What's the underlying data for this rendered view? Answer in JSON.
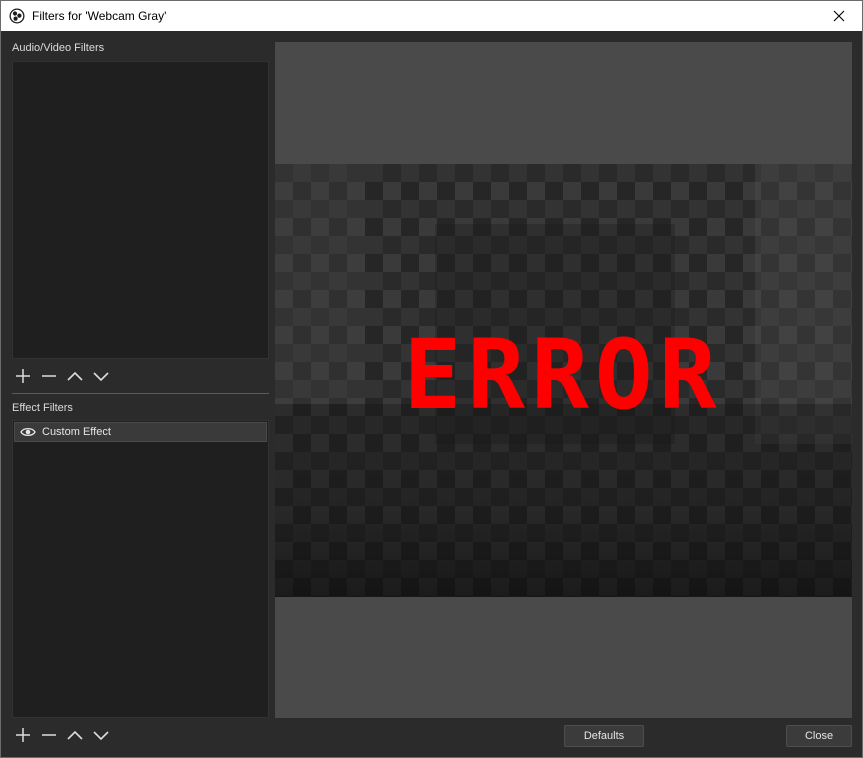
{
  "window": {
    "title": "Filters for 'Webcam Gray'"
  },
  "audio_video_filters": {
    "label": "Audio/Video Filters",
    "items": []
  },
  "effect_filters": {
    "label": "Effect Filters",
    "items": [
      {
        "label": "Custom Effect",
        "visible": true
      }
    ]
  },
  "preview": {
    "error_text": "ERROR"
  },
  "buttons": {
    "defaults": "Defaults",
    "close": "Close"
  },
  "icons": {
    "app": "obs-logo-icon",
    "close": "close-icon",
    "add": "plus-icon",
    "remove": "minus-icon",
    "up": "chevron-up-icon",
    "down": "chevron-down-icon",
    "visibility": "eye-icon"
  },
  "colors": {
    "error_red": "#ff0000",
    "window_bg": "#2b2b2b",
    "list_bg": "#1f1f1f",
    "preview_bg": "#4a4a4a"
  }
}
